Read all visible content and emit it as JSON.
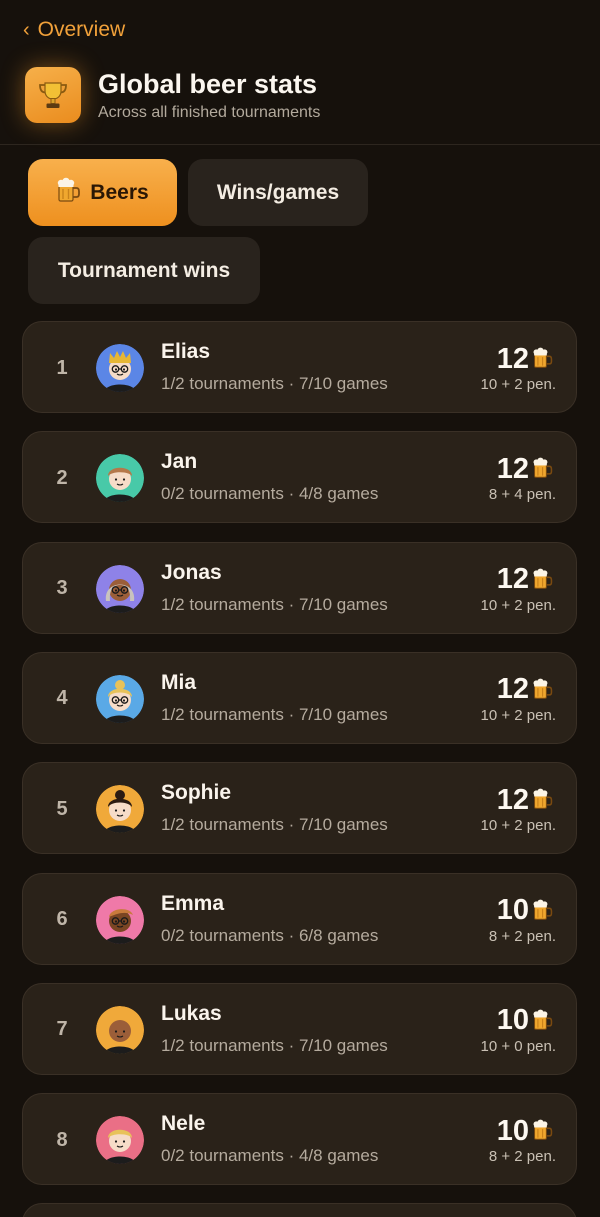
{
  "nav": {
    "back_label": "Overview",
    "back_icon": "chevron-left-icon"
  },
  "header": {
    "icon": "trophy-icon",
    "title": "Global beer stats",
    "subtitle": "Across all finished tournaments"
  },
  "tabs": [
    {
      "label": "Beers",
      "icon": "beer-mug-icon",
      "active": true
    },
    {
      "label": "Wins/games",
      "active": false
    },
    {
      "label": "Tournament wins",
      "active": false
    }
  ],
  "colors": {
    "accent": "#f1a13a",
    "background": "#16110c",
    "card": "#2a2219"
  },
  "leaderboard": [
    {
      "rank": "1",
      "name": "Elias",
      "meta": "1/2 tournaments · 7/10 games",
      "score": "12",
      "penalty": "10 + 2 pen.",
      "avatar": {
        "bg": "#5b86e6",
        "skin": "#f6dcc8",
        "hair": "#e7b735",
        "hair_style": "crown",
        "glasses": true
      }
    },
    {
      "rank": "2",
      "name": "Jan",
      "meta": "0/2 tournaments · 4/8 games",
      "score": "12",
      "penalty": "8 + 4 pen.",
      "avatar": {
        "bg": "#48c9a8",
        "skin": "#f6dcc8",
        "hair": "#b5784a",
        "hair_style": "short",
        "glasses": false
      }
    },
    {
      "rank": "3",
      "name": "Jonas",
      "meta": "1/2 tournaments · 7/10 games",
      "score": "12",
      "penalty": "10 + 2 pen.",
      "avatar": {
        "bg": "#8e82e8",
        "skin": "#9b5e39",
        "hair": "#c9c3bd",
        "hair_style": "long",
        "glasses": true
      }
    },
    {
      "rank": "4",
      "name": "Mia",
      "meta": "1/2 tournaments · 7/10 games",
      "score": "12",
      "penalty": "10 + 2 pen.",
      "avatar": {
        "bg": "#5aa9e6",
        "skin": "#f6dcc8",
        "hair": "#e8c25a",
        "hair_style": "bun",
        "glasses": true
      }
    },
    {
      "rank": "5",
      "name": "Sophie",
      "meta": "1/2 tournaments · 7/10 games",
      "score": "12",
      "penalty": "10 + 2 pen.",
      "avatar": {
        "bg": "#f0a93a",
        "skin": "#f6dcc8",
        "hair": "#2b1b12",
        "hair_style": "bun",
        "glasses": false
      }
    },
    {
      "rank": "6",
      "name": "Emma",
      "meta": "0/2 tournaments · 6/8 games",
      "score": "10",
      "penalty": "8 + 2 pen.",
      "avatar": {
        "bg": "#ef79a8",
        "skin": "#7a4523",
        "hair": "#c87a3c",
        "hair_style": "side",
        "glasses": true
      }
    },
    {
      "rank": "7",
      "name": "Lukas",
      "meta": "1/2 tournaments · 7/10 games",
      "score": "10",
      "penalty": "10 + 0 pen.",
      "avatar": {
        "bg": "#f0a93a",
        "skin": "#9b5e39",
        "hair": "#9b5e39",
        "hair_style": "bald",
        "glasses": false
      }
    },
    {
      "rank": "8",
      "name": "Nele",
      "meta": "0/2 tournaments · 4/8 games",
      "score": "10",
      "penalty": "8 + 2 pen.",
      "avatar": {
        "bg": "#ea6f86",
        "skin": "#f6dcc8",
        "hair": "#e8c25a",
        "hair_style": "short",
        "glasses": false
      }
    }
  ]
}
